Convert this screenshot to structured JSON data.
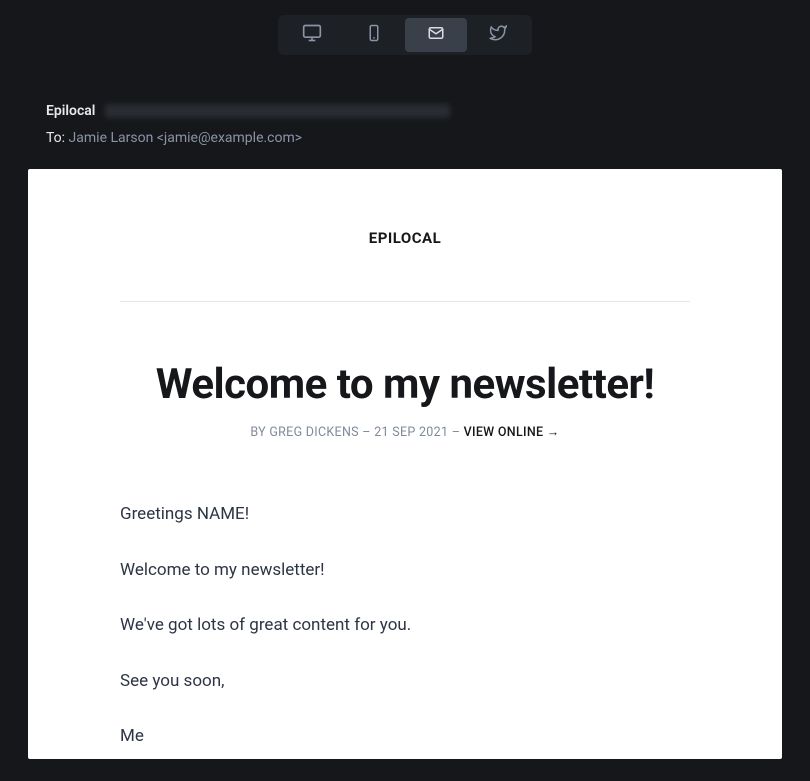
{
  "tabs": {
    "desktop": "desktop",
    "mobile": "mobile",
    "email": "email",
    "twitter": "twitter",
    "active": "email"
  },
  "meta": {
    "from_name": "Epilocal",
    "to_label": "To:",
    "to_value": "Jamie Larson <jamie@example.com>"
  },
  "email": {
    "brand": "EPILOCAL",
    "title": "Welcome to my newsletter!",
    "byline_prefix": "BY ",
    "author": "GREG DICKENS",
    "sep1": " – ",
    "date": "21 SEP 2021",
    "sep2": " – ",
    "view_online": "VIEW ONLINE →",
    "paragraphs": [
      "Greetings NAME!",
      "Welcome to my newsletter!",
      "We've got lots of great content for you.",
      "See you soon,",
      "Me"
    ]
  }
}
